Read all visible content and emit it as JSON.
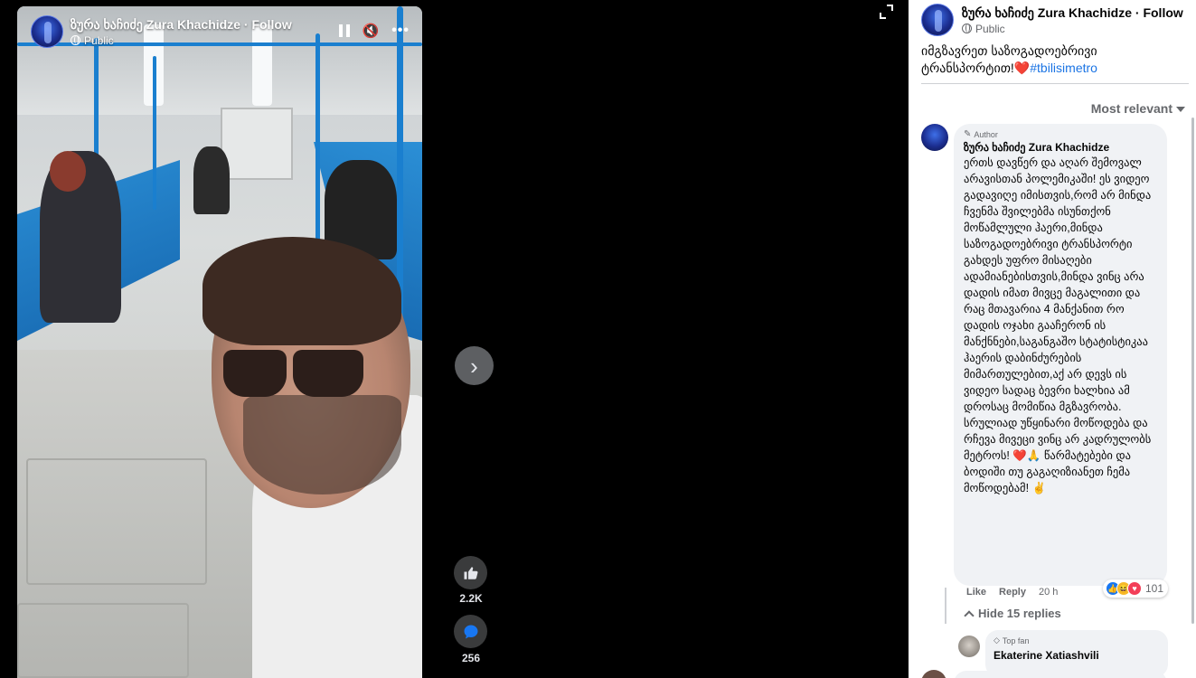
{
  "author": {
    "name": "ზურა ხაჩიძე Zura Khachidze",
    "follow_label": "· Follow",
    "audience": "Public"
  },
  "post": {
    "caption": "იმგზავრეთ საზოგადოებრივი ტრანსპორტით!",
    "heart": "❤️",
    "hashtag": "#tbilisimetro"
  },
  "video": {
    "likes": "2.2K",
    "comments": "256"
  },
  "comments_section": {
    "sort_label": "Most relevant",
    "top_comment": {
      "badge": "Author",
      "name": "ზურა ხაჩიძე Zura Khachidze",
      "text": "ერთს დავწერ და აღარ შემოვალ არავისთან პოლემიკაში! ეს ვიდეო გადავიღე იმისთვის,რომ არ მინდა ჩვენმა შვილებმა ისუნთქონ მოწამლული ჰაერი,მინდა საზოგადოებრივი ტრანსპორტი გახდეს უფრო მისაღები ადამიანებისთვის,მინდა ვინც არა დადის იმათ მივცე მაგალითი და რაც მთავარია 4 მანქანით რო დადის ოჯახი გააჩერონ ის მანქნნები,საგანგაშო სტატისტიკაა ჰაერის დაბინძურების მიმართულებით,აქ არ დევს ის ვიდეო სადაც ბევრი ხალხია ამ დროსაც მომიწია მგზავრობა. სრულიად უწყინარი მოწოდება და რჩევა მივეცი ვინც არ კადრულობს მეტროს!",
      "emoji_tail": "❤️🙏",
      "text_tail": "წარმატებები და ბოდიში თუ გაგაღიზიანეთ ჩემა მოწოდებამ!",
      "emoji_end": "✌️",
      "like_label": "Like",
      "reply_label": "Reply",
      "time": "20 h",
      "reaction_count": "101"
    },
    "hide_replies_label": "Hide 15 replies",
    "reply": {
      "badge": "Top fan",
      "name": "Ekaterine Xatiashvili"
    }
  },
  "colors": {
    "accent": "#1b74e4",
    "heart": "#e0245e",
    "metro_blue": "#1a7fcf"
  },
  "icons": [
    "pause-icon",
    "mute-icon",
    "more-icon",
    "fullscreen-icon",
    "chevron-right-icon",
    "like-icon",
    "comment-icon",
    "globe-icon",
    "pencil-icon"
  ]
}
